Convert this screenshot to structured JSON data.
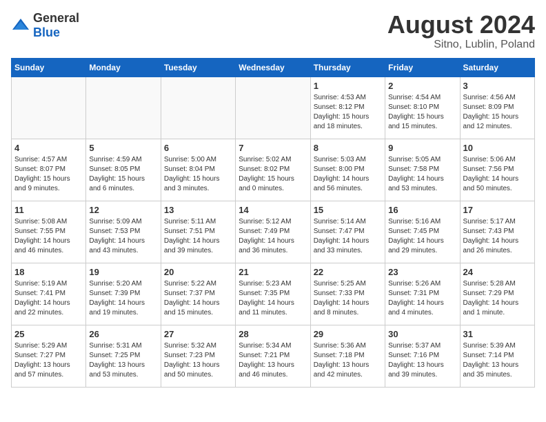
{
  "header": {
    "logo": {
      "general": "General",
      "blue": "Blue"
    },
    "month": "August 2024",
    "location": "Sitno, Lublin, Poland"
  },
  "weekdays": [
    "Sunday",
    "Monday",
    "Tuesday",
    "Wednesday",
    "Thursday",
    "Friday",
    "Saturday"
  ],
  "weeks": [
    [
      {
        "day": "",
        "info": ""
      },
      {
        "day": "",
        "info": ""
      },
      {
        "day": "",
        "info": ""
      },
      {
        "day": "",
        "info": ""
      },
      {
        "day": "1",
        "info": "Sunrise: 4:53 AM\nSunset: 8:12 PM\nDaylight: 15 hours\nand 18 minutes."
      },
      {
        "day": "2",
        "info": "Sunrise: 4:54 AM\nSunset: 8:10 PM\nDaylight: 15 hours\nand 15 minutes."
      },
      {
        "day": "3",
        "info": "Sunrise: 4:56 AM\nSunset: 8:09 PM\nDaylight: 15 hours\nand 12 minutes."
      }
    ],
    [
      {
        "day": "4",
        "info": "Sunrise: 4:57 AM\nSunset: 8:07 PM\nDaylight: 15 hours\nand 9 minutes."
      },
      {
        "day": "5",
        "info": "Sunrise: 4:59 AM\nSunset: 8:05 PM\nDaylight: 15 hours\nand 6 minutes."
      },
      {
        "day": "6",
        "info": "Sunrise: 5:00 AM\nSunset: 8:04 PM\nDaylight: 15 hours\nand 3 minutes."
      },
      {
        "day": "7",
        "info": "Sunrise: 5:02 AM\nSunset: 8:02 PM\nDaylight: 15 hours\nand 0 minutes."
      },
      {
        "day": "8",
        "info": "Sunrise: 5:03 AM\nSunset: 8:00 PM\nDaylight: 14 hours\nand 56 minutes."
      },
      {
        "day": "9",
        "info": "Sunrise: 5:05 AM\nSunset: 7:58 PM\nDaylight: 14 hours\nand 53 minutes."
      },
      {
        "day": "10",
        "info": "Sunrise: 5:06 AM\nSunset: 7:56 PM\nDaylight: 14 hours\nand 50 minutes."
      }
    ],
    [
      {
        "day": "11",
        "info": "Sunrise: 5:08 AM\nSunset: 7:55 PM\nDaylight: 14 hours\nand 46 minutes."
      },
      {
        "day": "12",
        "info": "Sunrise: 5:09 AM\nSunset: 7:53 PM\nDaylight: 14 hours\nand 43 minutes."
      },
      {
        "day": "13",
        "info": "Sunrise: 5:11 AM\nSunset: 7:51 PM\nDaylight: 14 hours\nand 39 minutes."
      },
      {
        "day": "14",
        "info": "Sunrise: 5:12 AM\nSunset: 7:49 PM\nDaylight: 14 hours\nand 36 minutes."
      },
      {
        "day": "15",
        "info": "Sunrise: 5:14 AM\nSunset: 7:47 PM\nDaylight: 14 hours\nand 33 minutes."
      },
      {
        "day": "16",
        "info": "Sunrise: 5:16 AM\nSunset: 7:45 PM\nDaylight: 14 hours\nand 29 minutes."
      },
      {
        "day": "17",
        "info": "Sunrise: 5:17 AM\nSunset: 7:43 PM\nDaylight: 14 hours\nand 26 minutes."
      }
    ],
    [
      {
        "day": "18",
        "info": "Sunrise: 5:19 AM\nSunset: 7:41 PM\nDaylight: 14 hours\nand 22 minutes."
      },
      {
        "day": "19",
        "info": "Sunrise: 5:20 AM\nSunset: 7:39 PM\nDaylight: 14 hours\nand 19 minutes."
      },
      {
        "day": "20",
        "info": "Sunrise: 5:22 AM\nSunset: 7:37 PM\nDaylight: 14 hours\nand 15 minutes."
      },
      {
        "day": "21",
        "info": "Sunrise: 5:23 AM\nSunset: 7:35 PM\nDaylight: 14 hours\nand 11 minutes."
      },
      {
        "day": "22",
        "info": "Sunrise: 5:25 AM\nSunset: 7:33 PM\nDaylight: 14 hours\nand 8 minutes."
      },
      {
        "day": "23",
        "info": "Sunrise: 5:26 AM\nSunset: 7:31 PM\nDaylight: 14 hours\nand 4 minutes."
      },
      {
        "day": "24",
        "info": "Sunrise: 5:28 AM\nSunset: 7:29 PM\nDaylight: 14 hours\nand 1 minute."
      }
    ],
    [
      {
        "day": "25",
        "info": "Sunrise: 5:29 AM\nSunset: 7:27 PM\nDaylight: 13 hours\nand 57 minutes."
      },
      {
        "day": "26",
        "info": "Sunrise: 5:31 AM\nSunset: 7:25 PM\nDaylight: 13 hours\nand 53 minutes."
      },
      {
        "day": "27",
        "info": "Sunrise: 5:32 AM\nSunset: 7:23 PM\nDaylight: 13 hours\nand 50 minutes."
      },
      {
        "day": "28",
        "info": "Sunrise: 5:34 AM\nSunset: 7:21 PM\nDaylight: 13 hours\nand 46 minutes."
      },
      {
        "day": "29",
        "info": "Sunrise: 5:36 AM\nSunset: 7:18 PM\nDaylight: 13 hours\nand 42 minutes."
      },
      {
        "day": "30",
        "info": "Sunrise: 5:37 AM\nSunset: 7:16 PM\nDaylight: 13 hours\nand 39 minutes."
      },
      {
        "day": "31",
        "info": "Sunrise: 5:39 AM\nSunset: 7:14 PM\nDaylight: 13 hours\nand 35 minutes."
      }
    ]
  ]
}
